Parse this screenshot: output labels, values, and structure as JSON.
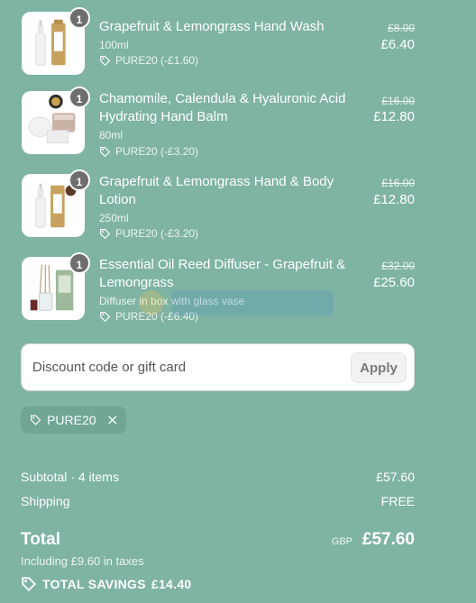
{
  "items": [
    {
      "qty": "1",
      "title": "Grapefruit & Lemongrass Hand Wash",
      "variant": "100ml",
      "discount": "PURE20 (-£1.60)",
      "original_price": "£8.00",
      "price": "£6.40",
      "image_icon": "hand-wash-bottles-image"
    },
    {
      "qty": "1",
      "title": "Chamomile, Calendula & Hyaluronic Acid Hydrating Hand Balm",
      "variant": "80ml",
      "discount": "PURE20 (-£3.20)",
      "original_price": "£16.00",
      "price": "£12.80",
      "image_icon": "hand-balm-jars-image"
    },
    {
      "qty": "1",
      "title": "Grapefruit & Lemongrass Hand & Body Lotion",
      "variant": "250ml",
      "discount": "PURE20 (-£3.20)",
      "original_price": "£16.00",
      "price": "£12.80",
      "image_icon": "body-lotion-bottles-image"
    },
    {
      "qty": "1",
      "title": "Essential Oil Reed Diffuser - Grapefruit & Lemongrass",
      "variant": "Diffuser in box with glass vase",
      "discount": "PURE20 (-£6.40)",
      "original_price": "£32.00",
      "price": "£25.60",
      "image_icon": "reed-diffuser-image"
    }
  ],
  "discount_field": {
    "placeholder": "Discount code or gift card",
    "apply_label": "Apply"
  },
  "applied_code": "PURE20",
  "summary": {
    "subtotal_label": "Subtotal · 4 items",
    "subtotal_value": "£57.60",
    "shipping_label": "Shipping",
    "shipping_value": "FREE",
    "total_label": "Total",
    "currency": "GBP",
    "total_value": "£57.60",
    "taxes_note": "Including £9.60 in taxes",
    "savings_label": "TOTAL SAVINGS",
    "savings_value": "£14.40"
  },
  "colors": {
    "background": "#7fb3a3",
    "chip": "#71a696",
    "qty_badge": "#6e6e6e"
  }
}
